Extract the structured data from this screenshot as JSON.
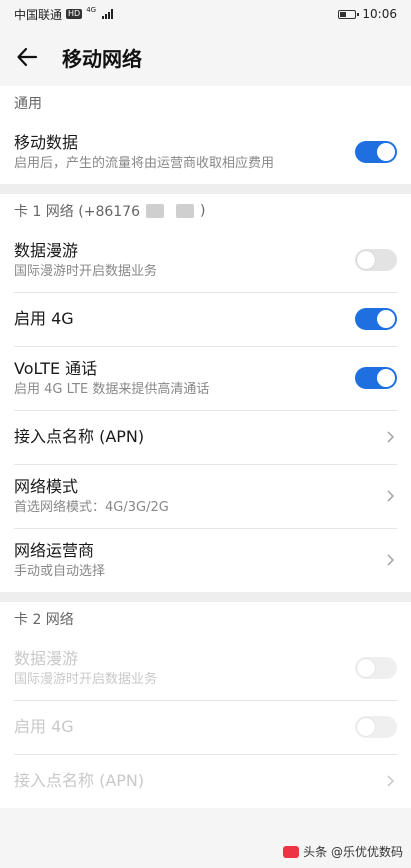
{
  "status_bar": {
    "carrier": "中国联通",
    "hd": "HD",
    "network": "4G",
    "time": "10:06"
  },
  "app_bar": {
    "title": "移动网络"
  },
  "general": {
    "header": "通用",
    "mobile_data": {
      "title": "移动数据",
      "subtitle": "启用后，产生的流量将由运营商收取相应费用",
      "enabled": true
    }
  },
  "sim1": {
    "header_prefix": "卡 1 网络 (+86176",
    "header_suffix": ")",
    "roaming": {
      "title": "数据漫游",
      "subtitle": "国际漫游时开启数据业务",
      "enabled": false
    },
    "enable_4g": {
      "title": "启用 4G",
      "enabled": true
    },
    "volte": {
      "title": "VoLTE 通话",
      "subtitle": "启用 4G LTE 数据来提供高清通话",
      "enabled": true
    },
    "apn": {
      "title": "接入点名称 (APN)"
    },
    "network_mode": {
      "title": "网络模式",
      "subtitle": "首选网络模式：4G/3G/2G"
    },
    "carrier": {
      "title": "网络运营商",
      "subtitle": "手动或自动选择"
    }
  },
  "sim2": {
    "header": "卡 2 网络",
    "roaming": {
      "title": "数据漫游",
      "subtitle": "国际漫游时开启数据业务"
    },
    "enable_4g": {
      "title": "启用 4G"
    },
    "apn": {
      "title": "接入点名称 (APN)"
    }
  },
  "watermark": {
    "text": "头条 @乐优优数码"
  },
  "colors": {
    "accent": "#1e6fe0",
    "toggle_off": "#e3e3e3",
    "background": "#f5f5f5"
  },
  "icons": {
    "back": "arrow-left-icon",
    "chevron": "chevron-right-icon",
    "battery": "battery-icon",
    "signal": "signal-icon"
  }
}
